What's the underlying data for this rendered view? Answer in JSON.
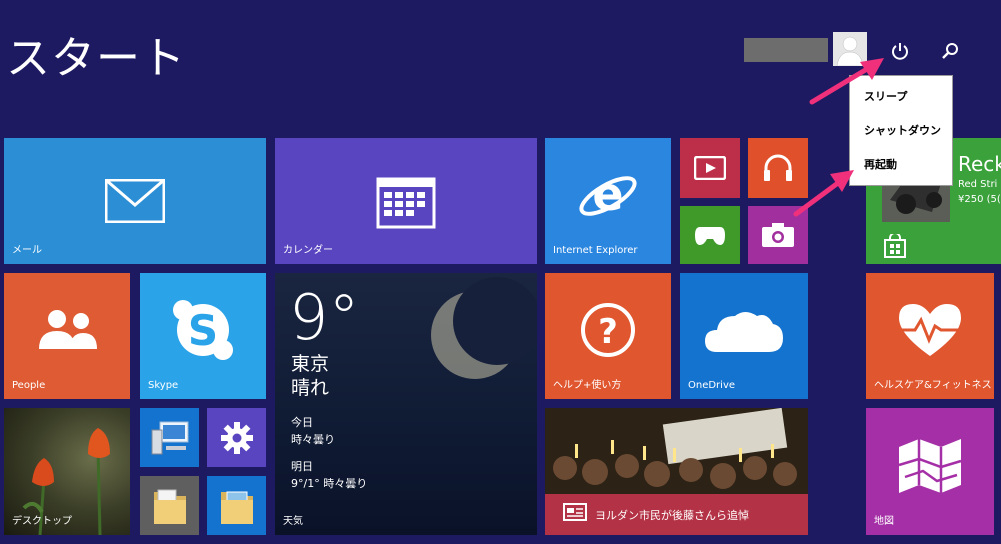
{
  "header": {
    "title": "スタート",
    "power_icon": "power-icon",
    "search_icon": "search-icon",
    "user_icon": "user-silhouette-icon"
  },
  "power_menu": {
    "items": [
      "スリープ",
      "シャットダウン",
      "再起動"
    ]
  },
  "tiles": {
    "mail": {
      "label": "メール",
      "color": "#2c8fd6"
    },
    "calendar": {
      "label": "カレンダー",
      "color": "#5a45c0"
    },
    "ie": {
      "label": "Internet Explorer",
      "color": "#2b86e0"
    },
    "video": {
      "color": "#bd2f48"
    },
    "music": {
      "color": "#e0502a"
    },
    "games": {
      "color": "#3f9a2a"
    },
    "camera": {
      "color": "#a1309e"
    },
    "people": {
      "label": "People",
      "color": "#df5b33"
    },
    "skype": {
      "label": "Skype",
      "color": "#2aa3e8"
    },
    "weather": {
      "temp": "9°",
      "city": "東京",
      "condition": "晴れ",
      "today_label": "今日",
      "today_cond": "時々曇り",
      "tomorrow_label": "明日",
      "tomorrow_forecast": "9°/1° 時々曇り",
      "label": "天気"
    },
    "help": {
      "label": "ヘルプ+使い方",
      "color": "#e0562f"
    },
    "onedrive": {
      "label": "OneDrive",
      "color": "#1473ce"
    },
    "desktop": {
      "label": "デスクトップ"
    },
    "news": {
      "label": "ヨルダン市民が後藤さんら追悼",
      "color": "#b43245"
    },
    "store": {
      "title": "Reck",
      "sub1": "Red Stri",
      "sub2": "¥250 (5(",
      "color": "#3aa13b"
    },
    "health": {
      "label": "ヘルスケア&フィットネス",
      "color": "#e0562f"
    },
    "maps": {
      "label": "地図",
      "color": "#a52fa6"
    }
  },
  "colors": {
    "background": "#1e1a62",
    "arrow": "#f0307a",
    "menu_bg": "#ffffff"
  }
}
